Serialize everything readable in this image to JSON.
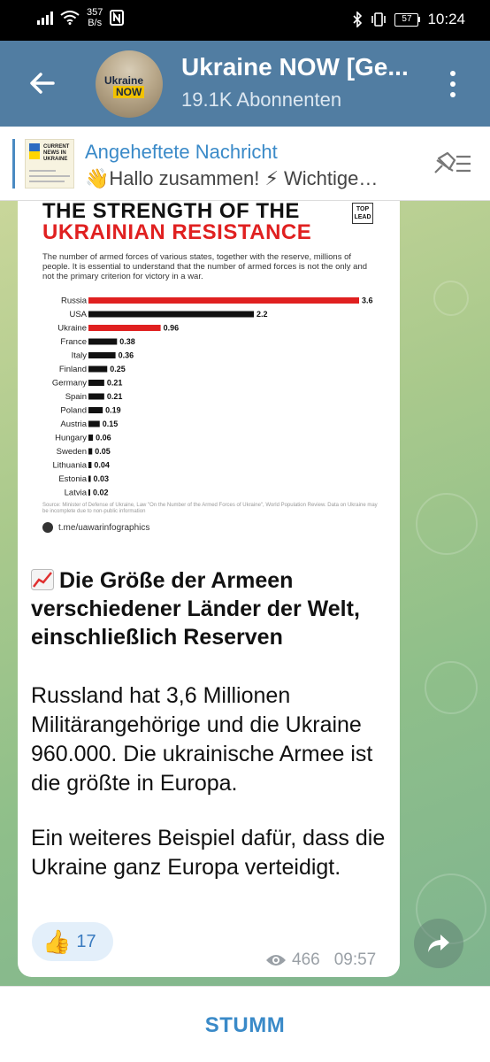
{
  "status_bar": {
    "speed": "357",
    "speed_unit": "B/s",
    "battery": "57",
    "time": "10:24"
  },
  "header": {
    "title": "Ukraine NOW [Ge...",
    "subtitle": "19.1K Abonnenten",
    "avatar_text_line1": "Ukraine",
    "avatar_text_line2": "NOW"
  },
  "pinned": {
    "title": "Angeheftete Nachricht",
    "text": "👋Hallo zusammen! ⚡ Wichtige…",
    "thumb_text": "CURRENT NEWS IN UKRAINE"
  },
  "infographic": {
    "title_line1": "THE STRENGTH OF THE",
    "title_line2": "UKRAINIAN RESISTANCE",
    "logo": "TOP LEAD",
    "description": "The number of armed forces of various states, together with the reserve, millions of people. It is essential to understand that the number of armed forces is not the only and not the primary criterion for victory in a war.",
    "source": "Source: Minister of Defense of Ukraine, Law \"On the Number of the Armed Forces of Ukraine\", World Population Review. Data on Ukraine may be incomplete due to non-public information",
    "link": "t.me/uawarinfographics"
  },
  "chart_data": {
    "type": "bar",
    "orientation": "horizontal",
    "categories": [
      "Russia",
      "USA",
      "Ukraine",
      "France",
      "Italy",
      "Finland",
      "Germany",
      "Spain",
      "Poland",
      "Austria",
      "Hungary",
      "Sweden",
      "Lithuania",
      "Estonia",
      "Latvia"
    ],
    "values": [
      3.6,
      2.2,
      0.96,
      0.38,
      0.36,
      0.25,
      0.21,
      0.21,
      0.19,
      0.15,
      0.06,
      0.05,
      0.04,
      0.03,
      0.02
    ],
    "labels": [
      "3.6",
      "2.2",
      "0.96",
      "0.38",
      "0.36",
      "0.25",
      "0.21",
      "0.21",
      "0.19",
      "0.15",
      "0.06",
      "0.05",
      "0.04",
      "0.03",
      "0.02"
    ],
    "highlight": [
      "Russia",
      "Ukraine"
    ],
    "colors": {
      "highlight": "#e02020",
      "default": "#111111"
    },
    "xlim": [
      0,
      3.6
    ]
  },
  "message": {
    "heading": "Die Größe der Armeen verschiedener Länder der Welt, einschließlich Reserven",
    "heading_icon": "chart-increasing-icon",
    "paragraph1": "Russland hat 3,6 Millionen Militärangehörige und die Ukraine 960.000. Die ukrainische Armee ist die größte in Europa.",
    "paragraph2": "Ein weiteres Beispiel dafür, dass die Ukraine ganz Europa verteidigt.",
    "reaction_emoji": "👍",
    "reaction_count": "17",
    "views": "466",
    "time": "09:57"
  },
  "bottom": {
    "mute_label": "STUMM"
  },
  "colors": {
    "header": "#517da2",
    "accent": "#3a8ac8",
    "reaction_bg": "#e3effa"
  }
}
